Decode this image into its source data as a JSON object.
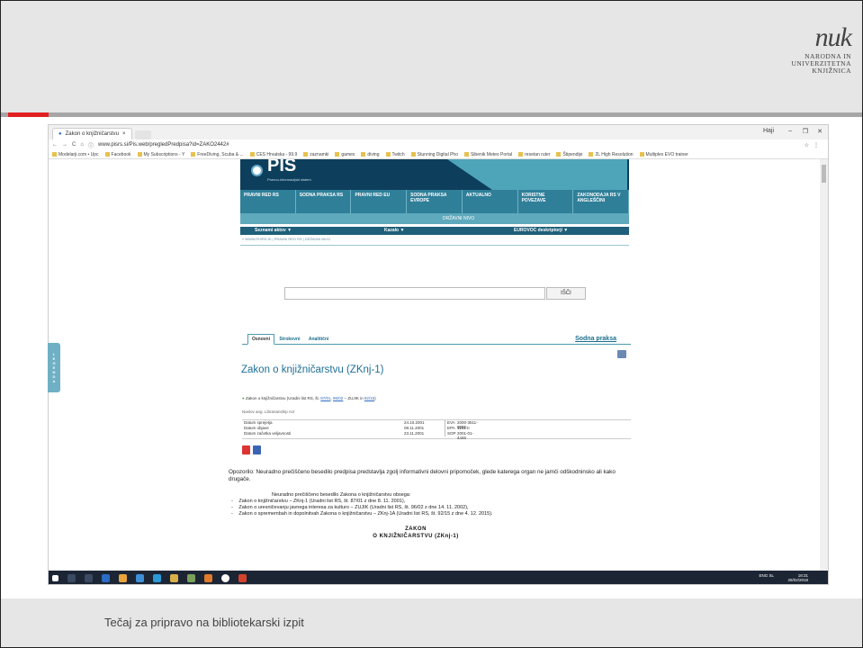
{
  "slide": {
    "footer": "Tečaj za pripravo na bibliotekarski izpit",
    "logo": {
      "mark": "nuk",
      "line1": "NARODNA IN",
      "line2": "UNIVERZITETNA",
      "line3": "KNJIŽNICA"
    },
    "accent_color": "#e02020"
  },
  "browser": {
    "tab_title": "Zakon o knjižničarstvu",
    "user": "Haji",
    "url": "www.pisrs.si/Pis.web/pregledPredpisa?id=ZAKO2442#",
    "bookmarks": [
      "Modelarji.com • Upc",
      "Facebook",
      "My Subscriptions - Y",
      "FreeDiving, Scuba & ...",
      "CES Hrvatska - 99.9",
      "zaznamki",
      "games",
      "diving",
      "Twitch",
      "Stunning Digital Pho",
      "Sibenik Meteo Portal",
      "resetan ruter",
      "Štipendije",
      "2L High Resolution",
      "Multiplex EVO trainer"
    ]
  },
  "pis": {
    "logo": "PIS",
    "logo_sub": "Pravno-informacijski sistem",
    "nav": [
      "PRAVNI RED RS",
      "SODNA PRAKSA RS",
      "PRAVNI RED EU",
      "SODNA PRAKSA EVROPE",
      "AKTUALNO",
      "KORISTNE POVEZAVE",
      "ZAKONODAJA RS V ANGLEŠČINI"
    ],
    "subnav": "DRŽAVNI NIVO",
    "bar3": [
      "Seznami aktov ▼",
      "Kazalo ▼",
      "EUROVOC deskriptorji ▼"
    ],
    "breadcrumb": "» WWW.PISRS.SI | PRAVNI RED RS | DRŽAVNI NIVO",
    "search_button": "IŠČI"
  },
  "document": {
    "tabs": [
      "Osnovni",
      "Strokovni",
      "Analitični"
    ],
    "sodna_link": "Sodna praksa",
    "title": "Zakon o knjižničarstvu (ZKnj-1)",
    "ref_prefix": "Zakon o knjižničarstvu (Uradni list RS, št. ",
    "ref_link1": "87/01",
    "ref_link2": "96/02",
    "ref_mid": " – ZUJIK in ",
    "ref_link3": "92/15",
    "ref_suffix": ")",
    "naslov": "Naslov ang. Librarianship Act",
    "meta": [
      {
        "label": "Datum sprejetja",
        "value": "24.10.2001",
        "code": "EVA",
        "code_value": "2000-3511-0002"
      },
      {
        "label": "Datum objave",
        "value": "08.11.2001",
        "code": "EPA",
        "code_value": "1141-II"
      },
      {
        "label": "Datum začetka veljavnosti",
        "value": "23.11.2001",
        "code": "SOP",
        "code_value": "2001-01-4446"
      }
    ],
    "opozorilo": "Opozorilo: Neuradno prečiščeno besedilo predpisa predstavlja zgolj informativni delovni pripomoček, glede katerega organ ne jamči odškodninsko ali kako drugače.",
    "precisceno": "Neuradno prečiščeno besedilo Zakona o knjižničarstvu obsega:",
    "amendments": [
      "Zakon o knjižničarstvu – ZKnj-1 (Uradni list RS, št. 87/01 z dne 8. 11. 2001),",
      "Zakon o uresničevanju javnega interesa za kulturo – ZUJIK (Uradni list RS, št. 96/02 z dne 14. 11. 2002),",
      "Zakon o spremembah in dopolnitvah Zakona o knjižničarstvu – ZKnj-1A (Uradni list RS, št. 92/15 z dne 4. 12. 2015)."
    ],
    "zakon_line1": "ZAKON",
    "zakon_line2": "O KNJIŽNIČARSTVU (ZKnj-1)"
  },
  "legenda": "LEGENDA",
  "taskbar": {
    "lang": "ENG SL",
    "time": "18:31",
    "date": "28/02/2018"
  }
}
